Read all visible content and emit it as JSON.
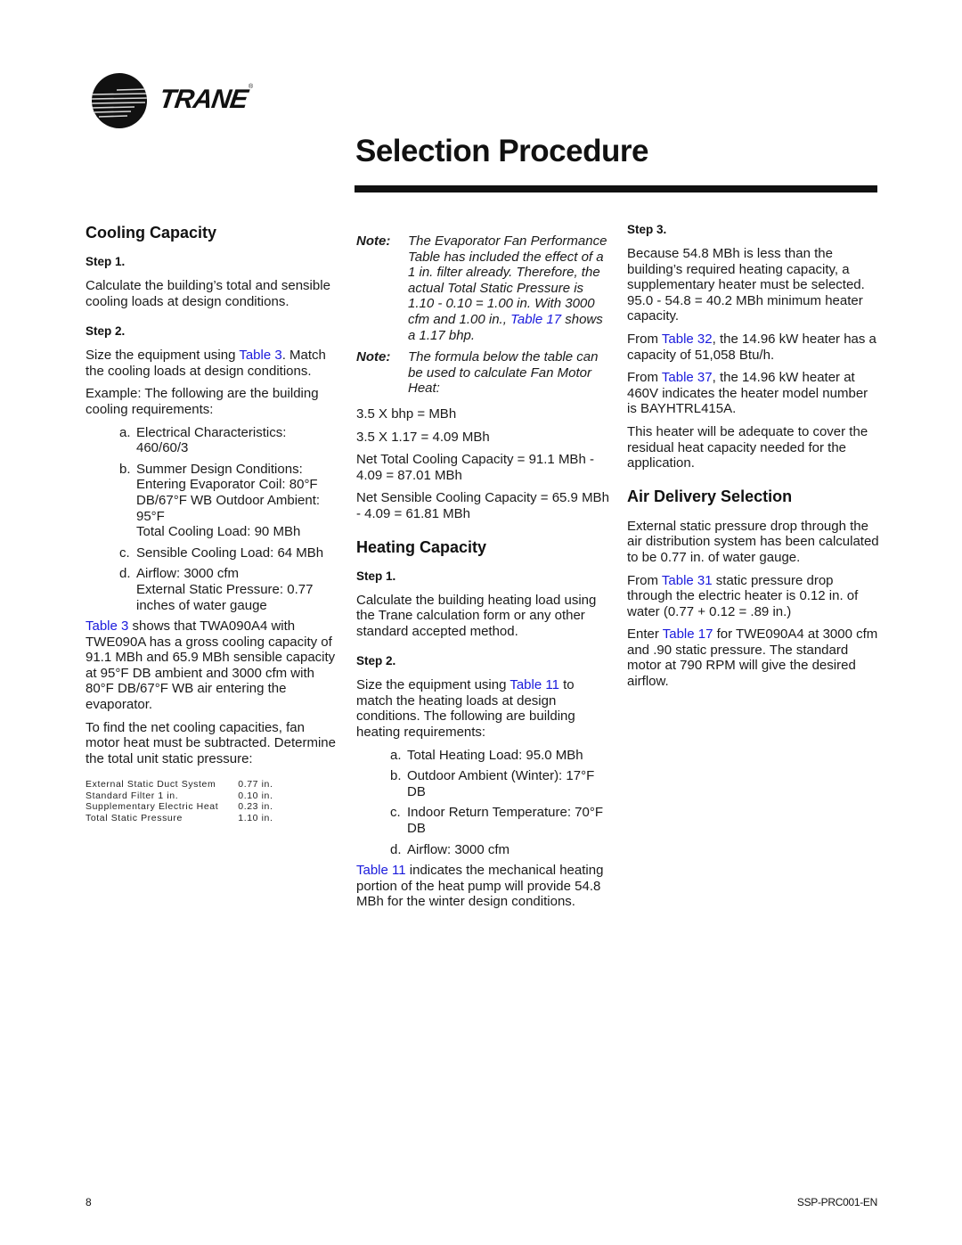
{
  "header": {
    "brand": "TRANE",
    "brand_mark": "®",
    "title": "Selection Procedure"
  },
  "cooling": {
    "heading": "Cooling Capacity",
    "step1_label": "Step 1.",
    "step1_text": "Calculate the building’s total and sensible cooling loads at design conditions.",
    "step2_label": "Step 2.",
    "step2_pre": "Size the equipment using ",
    "step2_link": "Table 3",
    "step2_post": ". Match the cooling loads at design conditions.",
    "example_intro": "Example: The following are the building cooling requirements:",
    "requirements": [
      {
        "marker": "a.",
        "text": "Electrical Characteristics: 460/60/3"
      },
      {
        "marker": "b.",
        "text": "Summer Design Conditions: Entering Evaporator Coil: 80°F DB/67°F WB Outdoor Ambient: 95°F",
        "extra": "Total Cooling Load: 90 MBh"
      },
      {
        "marker": "c.",
        "text": "Sensible Cooling Load: 64 MBh"
      },
      {
        "marker": "d.",
        "text": "Airflow: 3000 cfm",
        "extra": "External Static Pressure: 0.77 inches of water gauge"
      }
    ],
    "result_link": "Table 3",
    "result_text": " shows that TWA090A4 with TWE090A has a gross cooling capacity of 91.1 MBh and 65.9 MBh sensible capacity at 95°F DB ambient and 3000 cfm with 80°F DB/67°F WB air entering the evaporator.",
    "net_intro": "To find the net cooling capacities, fan motor heat must be subtracted. Determine the total unit static pressure:",
    "static_pressure": [
      {
        "label": "External Static Duct System",
        "value": "0.77 in."
      },
      {
        "label": "Standard Filter 1 in.",
        "value": "0.10 in."
      },
      {
        "label": "Supplementary Electric Heat",
        "value": "0.23 in."
      },
      {
        "label": "Total Static Pressure",
        "value": "1.10 in."
      }
    ]
  },
  "notes": {
    "label": "Note:",
    "note1_text": "The Evaporator Fan Performance Table has included the effect of a 1 in. filter already. Therefore, the actual Total Static Pressure is 1.10 - 0.10 = 1.00 in. With 3000 cfm and 1.00 in., ",
    "note1_link": "Table 17",
    "note1_post": " shows a 1.17 bhp.",
    "note2_text": "The formula below the table can be used to calculate Fan Motor Heat:",
    "formula1": "3.5 X bhp = MBh",
    "formula2": "3.5 X 1.17 = 4.09 MBh",
    "net_total": "Net Total Cooling Capacity = 91.1 MBh - 4.09 = 87.01 MBh",
    "net_sensible": "Net Sensible Cooling Capacity = 65.9 MBh - 4.09 = 61.81 MBh"
  },
  "heating": {
    "heading": "Heating Capacity",
    "step1_label": "Step 1.",
    "step1_text": "Calculate the building heating load using the Trane calculation form or any other standard accepted method.",
    "step2_label": "Step 2.",
    "step2_pre": "Size the equipment using ",
    "step2_link": "Table 11",
    "step2_post": " to match the heating loads at design conditions. The following are building heating requirements:",
    "requirements": [
      {
        "marker": "a.",
        "text": "Total Heating Load: 95.0 MBh"
      },
      {
        "marker": "b.",
        "text": "Outdoor Ambient (Winter): 17°F DB"
      },
      {
        "marker": "c.",
        "text": "Indoor Return Temperature: 70°F DB"
      },
      {
        "marker": "d.",
        "text": "Airflow: 3000 cfm"
      }
    ],
    "result_link": "Table 11",
    "result_text": " indicates the mechanical heating portion of the heat pump will provide 54.8 MBh for the winter design conditions.",
    "step3_label": "Step 3.",
    "step3_text": "Because 54.8 MBh is less than the building’s required heating capacity, a supplementary heater must be selected. 95.0 - 54.8 = 40.2 MBh minimum heater capacity.",
    "t32_pre": "From ",
    "t32_link": "Table 32",
    "t32_post": ", the 14.96 kW heater has a capacity of 51,058 Btu/h.",
    "t37_pre": "From ",
    "t37_link": "Table 37",
    "t37_post": ", the 14.96 kW heater at 460V indicates the heater model number is BAYHTRL415A.",
    "adequate": "This heater will be adequate to cover the residual heat capacity needed for the application."
  },
  "air_delivery": {
    "heading": "Air Delivery Selection",
    "p1": "External static pressure drop through the air distribution system has been calculated to be 0.77 in. of water gauge.",
    "p2_pre": "From ",
    "p2_link": "Table 31",
    "p2_post": " static pressure drop through the electric heater is 0.12 in. of water (0.77 + 0.12 = .89 in.)",
    "p3_pre": "Enter ",
    "p3_link": "Table 17",
    "p3_post": " for TWE090A4 at 3000 cfm and .90 static pressure. The standard motor at 790 RPM will give the desired airflow."
  },
  "footer": {
    "page_number": "8",
    "doc_id": "SSP-PRC001-EN"
  }
}
